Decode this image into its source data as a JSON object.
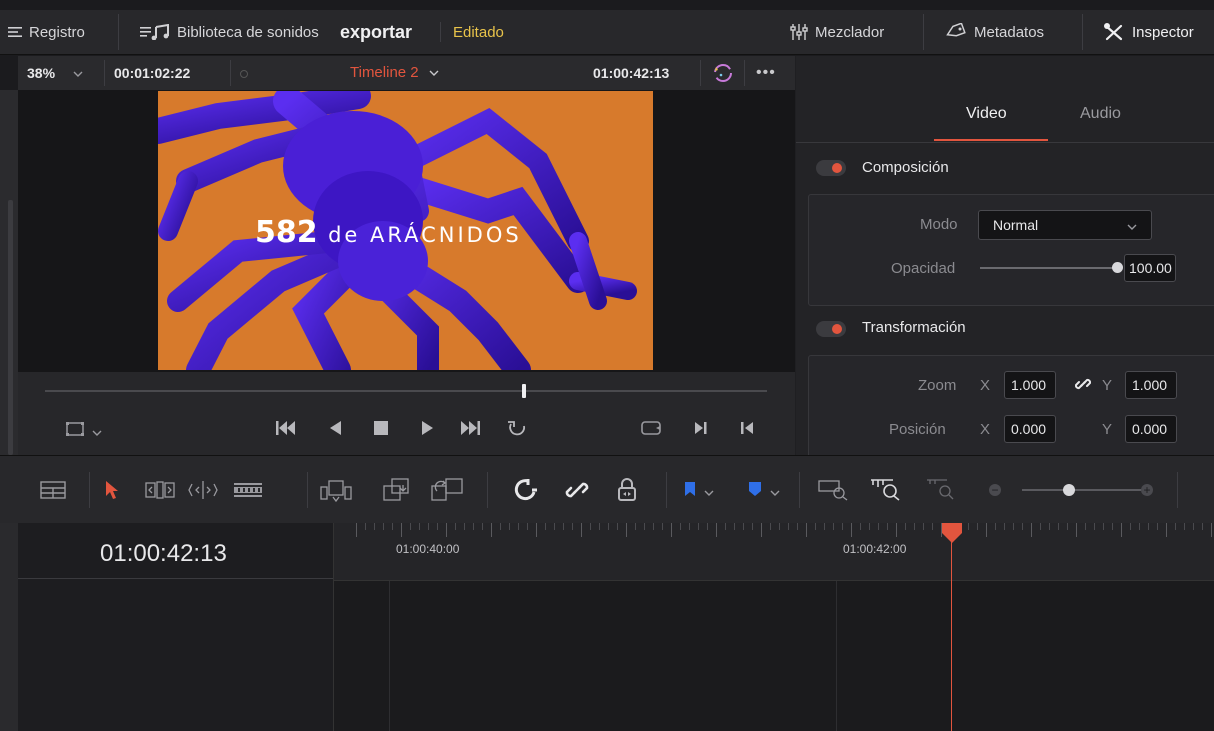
{
  "topbar": {
    "registro": "Registro",
    "sound_library": "Biblioteca de sonidos",
    "project_name": "exportar",
    "status": "Editado",
    "mixer": "Mezclador",
    "metadata": "Metadatos",
    "inspector": "Inspector"
  },
  "viewer": {
    "zoom": "38%",
    "timecode_left": "00:01:02:22",
    "timeline_name": "Timeline 2",
    "timecode_right": "01:00:42:13",
    "title_number": "582",
    "title_text": "de ARÁCNIDOS",
    "scrubber_position_pct": 66
  },
  "inspector": {
    "tab_video": "Video",
    "tab_audio": "Audio",
    "composite": {
      "header": "Composición",
      "mode_label": "Modo",
      "mode_value": "Normal",
      "opacity_label": "Opacidad",
      "opacity_value": "100.00"
    },
    "transform": {
      "header": "Transformación",
      "zoom_label": "Zoom",
      "x_label": "X",
      "y_label": "Y",
      "zoom_x": "1.000",
      "zoom_y": "1.000",
      "position_label": "Posición",
      "pos_x": "0.000",
      "pos_y": "0.000"
    }
  },
  "timeline": {
    "current_timecode": "01:00:42:13",
    "ruler_label_1": "01:00:40:00",
    "ruler_label_2": "01:00:42:00"
  },
  "colors": {
    "accent_red": "#e2553e",
    "status_yellow": "#e8c34a",
    "frame_orange": "#d77a2c",
    "spider_purple": "#4a1fd6",
    "marker_blue": "#2f6fe8"
  }
}
